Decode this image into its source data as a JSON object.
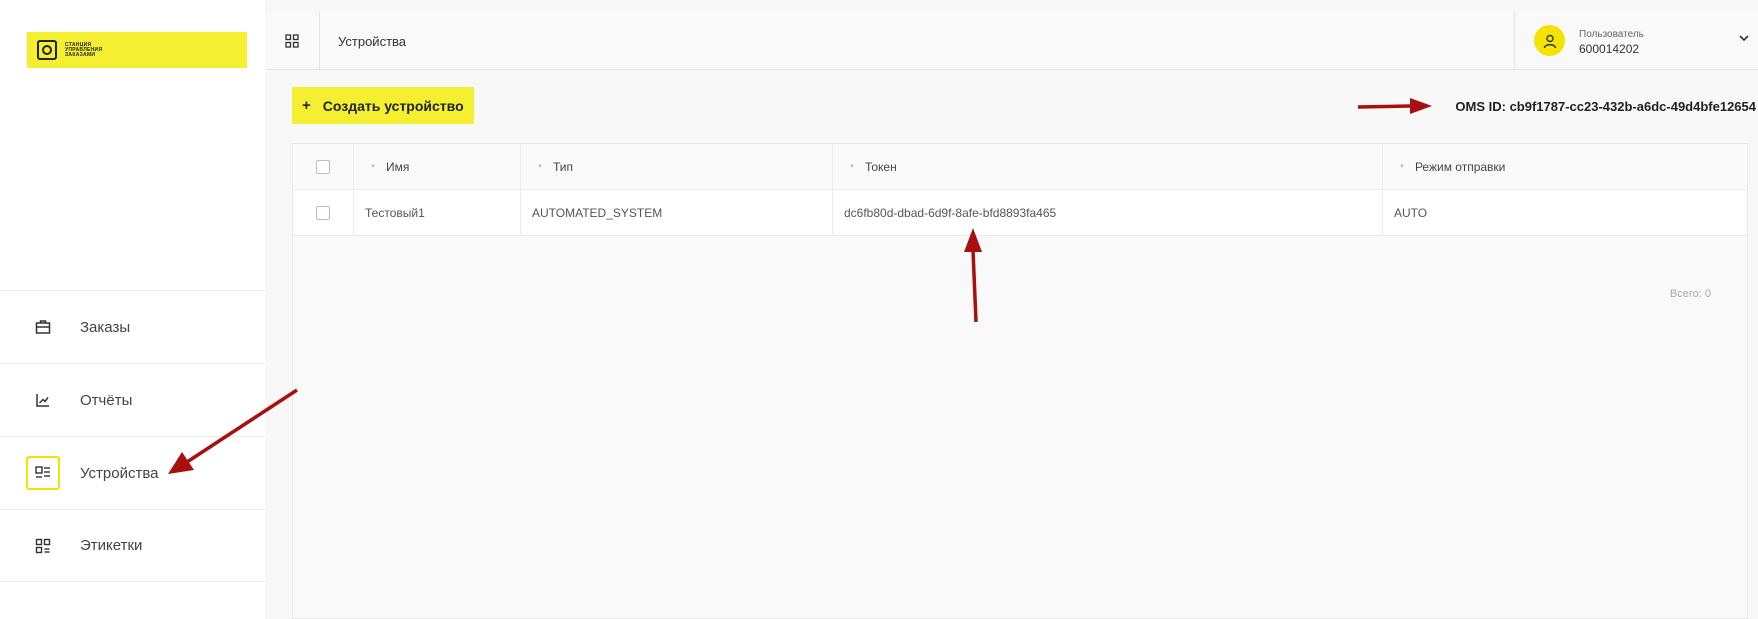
{
  "logo": {
    "lines": [
      "СТАНЦИЯ",
      "УПРАВЛЕНИЯ",
      "ЗАКАЗАМИ"
    ]
  },
  "sidebar": {
    "items": [
      {
        "label": "Заказы",
        "icon": "briefcase-icon"
      },
      {
        "label": "Отчёты",
        "icon": "chart-icon"
      },
      {
        "label": "Устройства",
        "icon": "devices-icon",
        "active": true
      },
      {
        "label": "Этикетки",
        "icon": "labels-icon"
      }
    ]
  },
  "header": {
    "title": "Устройства"
  },
  "user": {
    "label": "Пользователь",
    "id": "600014202"
  },
  "toolbar": {
    "create_label": "Создать устройство",
    "plus": "+"
  },
  "oms": {
    "text": "OMS ID: cb9f1787-cc23-432b-a6dc-49d4bfe12654"
  },
  "table": {
    "columns": [
      "Имя",
      "Тип",
      "Токен",
      "Режим отправки"
    ],
    "rows": [
      {
        "name": "Тестовый1",
        "type": "AUTOMATED_SYSTEM",
        "token": "dc6fb80d-dbad-6d9f-8afe-bfd8893fa465",
        "mode": "AUTO"
      }
    ],
    "total": "Всего: 0"
  },
  "colors": {
    "accent": "#f4f031",
    "arrow": "#a80f0f"
  }
}
